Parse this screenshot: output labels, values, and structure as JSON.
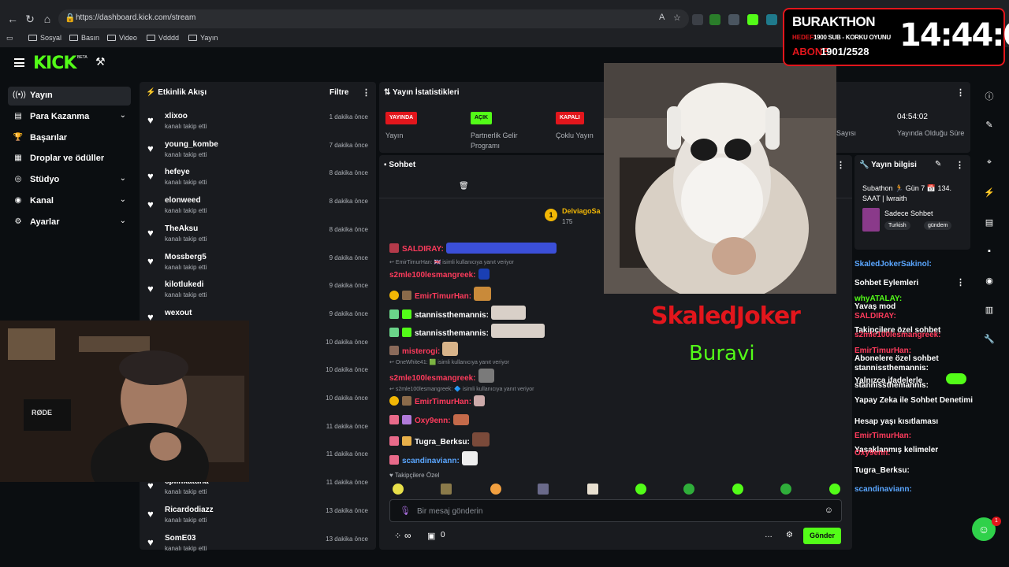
{
  "browser": {
    "url": "https://dashboard.kick.com/stream",
    "bookmarks": [
      "Sosyal",
      "Basın",
      "Video",
      "Vdddd",
      "Yayın"
    ]
  },
  "header": {
    "logo": "KICK",
    "beta": "BETA"
  },
  "sidebar": {
    "items": [
      {
        "label": "Yayın",
        "icon": "broadcast-icon"
      },
      {
        "label": "Para Kazanma",
        "icon": "money-icon"
      },
      {
        "label": "Başarılar",
        "icon": "trophy-icon"
      },
      {
        "label": "Droplar ve ödüller",
        "icon": "gift-icon"
      },
      {
        "label": "Stüdyo",
        "icon": "studio-icon"
      },
      {
        "label": "Kanal",
        "icon": "channel-icon"
      },
      {
        "label": "Ayarlar",
        "icon": "gear-icon"
      }
    ]
  },
  "activity": {
    "title": "Etkinlik Akışı",
    "filter": "Filtre",
    "action": "kanalı takip etti",
    "rows": [
      {
        "name": "xlixoo",
        "time": "1 dakika önce"
      },
      {
        "name": "young_kombe",
        "time": "7 dakika önce"
      },
      {
        "name": "hefeye",
        "time": "8 dakika önce"
      },
      {
        "name": "elonweed",
        "time": "8 dakika önce"
      },
      {
        "name": "TheAksu",
        "time": "8 dakika önce"
      },
      {
        "name": "Mossberg5",
        "time": "9 dakika önce"
      },
      {
        "name": "kilotlukedi",
        "time": "9 dakika önce"
      },
      {
        "name": "wexout",
        "time": "9 dakika önce"
      },
      {
        "name": "",
        "time": "10 dakika önce"
      },
      {
        "name": "",
        "time": "10 dakika önce"
      },
      {
        "name": "",
        "time": "10 dakika önce"
      },
      {
        "name": "",
        "time": "11 dakika önce"
      },
      {
        "name": "",
        "time": "11 dakika önce"
      },
      {
        "name": "cplinkatuna",
        "time": "11 dakika önce"
      },
      {
        "name": "Ricardodiazz",
        "time": "13 dakika önce"
      },
      {
        "name": "SomE03",
        "time": "13 dakika önce"
      }
    ]
  },
  "stats": {
    "title": "Yayın İstatistikleri",
    "live_badge": "YAYINDA",
    "on_badge": "AÇIK",
    "off_badge": "KAPALI",
    "live_label": "Yayın",
    "partner_label": "Partnerlik Gelir Programı",
    "multi_label": "Çoklu Yayın",
    "count_label": "Sayısı",
    "duration": "04:54:02",
    "duration_label": "Yayında Olduğu Süre"
  },
  "chat": {
    "title": "Sohbet",
    "pinned_user": "DelviagoSa",
    "pinned_count": "175",
    "followers_only": "Takipçilere Özel",
    "placeholder": "Bir mesaj gönderin",
    "viewers": "∞",
    "points": "0",
    "send": "Gönder",
    "messages": [
      {
        "user": "SALDIRAY:",
        "color": "#ff3b5c"
      },
      {
        "user": "s2mle100lesmangreek:",
        "color": "#ff3b5c"
      },
      {
        "user": "EmirTimurHan:",
        "color": "#ff3b5c"
      },
      {
        "user": "stannissthemannis:",
        "color": "#ffffff"
      },
      {
        "user": "stannissthemannis:",
        "color": "#ffffff"
      },
      {
        "user": "misterogi:",
        "color": "#ff3b5c"
      },
      {
        "user": "s2mle100lesmangreek:",
        "color": "#ff3b5c"
      },
      {
        "user": "EmirTimurHan:",
        "color": "#ff3b5c"
      },
      {
        "user": "Oxy9enn:",
        "color": "#ff3b5c"
      },
      {
        "user": "Tugra_Berksu:",
        "color": "#ffffff"
      },
      {
        "user": "scandinaviann:",
        "color": "#5aa6ff"
      }
    ],
    "replies": [
      {
        "from": "EmirTimurHan:",
        "text": "isimli kullanıcıya yanıt veriyor"
      },
      {
        "from": "OneWhite41:",
        "text": "isimli kullanıcıya yanıt veriyor"
      },
      {
        "from": "s2mle100lesmangreek:",
        "text": "isimli kullanıcıya yanıt veriyor"
      }
    ]
  },
  "overlay": {
    "title": "BURAKTHON",
    "hedef_label": "HEDEF:",
    "hedef_text": "1900 SUB - KORKU OYUNU",
    "abone_label": "ABONE",
    "abone_value": "1901/2528",
    "clock": "14:44:01"
  },
  "scene": {
    "name": "SkaledJoker",
    "sub": "Buravi",
    "cam_brand": "RØDE"
  },
  "info": {
    "title": "Yayın bilgisi",
    "stream_title": "Subathon 🏃 Gün 7 📅 134. SAAT | Iwraith",
    "category": "Sadece Sohbet",
    "tags": [
      "Turkish",
      "gündem"
    ]
  },
  "right_chat": [
    {
      "text": "SkaledJokerSakinol:",
      "color": "#5aa6ff"
    },
    {
      "text": "Sohbet Eylemleri",
      "color": "#ffffff"
    },
    {
      "text": "whyATALAY:",
      "color": "#53fc18"
    },
    {
      "text": "Yavaş mod",
      "color": "#ffffff"
    },
    {
      "text": "SALDIRAY:",
      "color": "#ff3b5c"
    },
    {
      "text": "Takipçilere özel sohbet",
      "color": "#ffffff"
    },
    {
      "text": "s2mle100lesmangreek:",
      "color": "#ff3b5c"
    },
    {
      "text": "EmirTimurHan:",
      "color": "#ff3b5c"
    },
    {
      "text": "Abonelere özel sohbet",
      "color": "#ffffff"
    },
    {
      "text": "stannissthemannis:",
      "color": "#ffffff"
    },
    {
      "text": "Yalnızca ifadelerle",
      "color": "#ffffff"
    },
    {
      "text": "stannissthemannis:",
      "color": "#ffffff"
    },
    {
      "text": "Yapay Zeka ile Sohbet Denetimi",
      "color": "#ffffff"
    },
    {
      "text": "Hesap yaşı kısıtlaması",
      "color": "#ffffff"
    },
    {
      "text": "EmirTimurHan:",
      "color": "#ff3b5c"
    },
    {
      "text": "Yasaklanmış kelimeler",
      "color": "#ffffff"
    },
    {
      "text": "Oxy9enn:",
      "color": "#ff3b5c"
    },
    {
      "text": "Tugra_Berksu:",
      "color": "#ffffff"
    },
    {
      "text": "scandinaviann:",
      "color": "#5aa6ff"
    }
  ],
  "notif_count": "1"
}
